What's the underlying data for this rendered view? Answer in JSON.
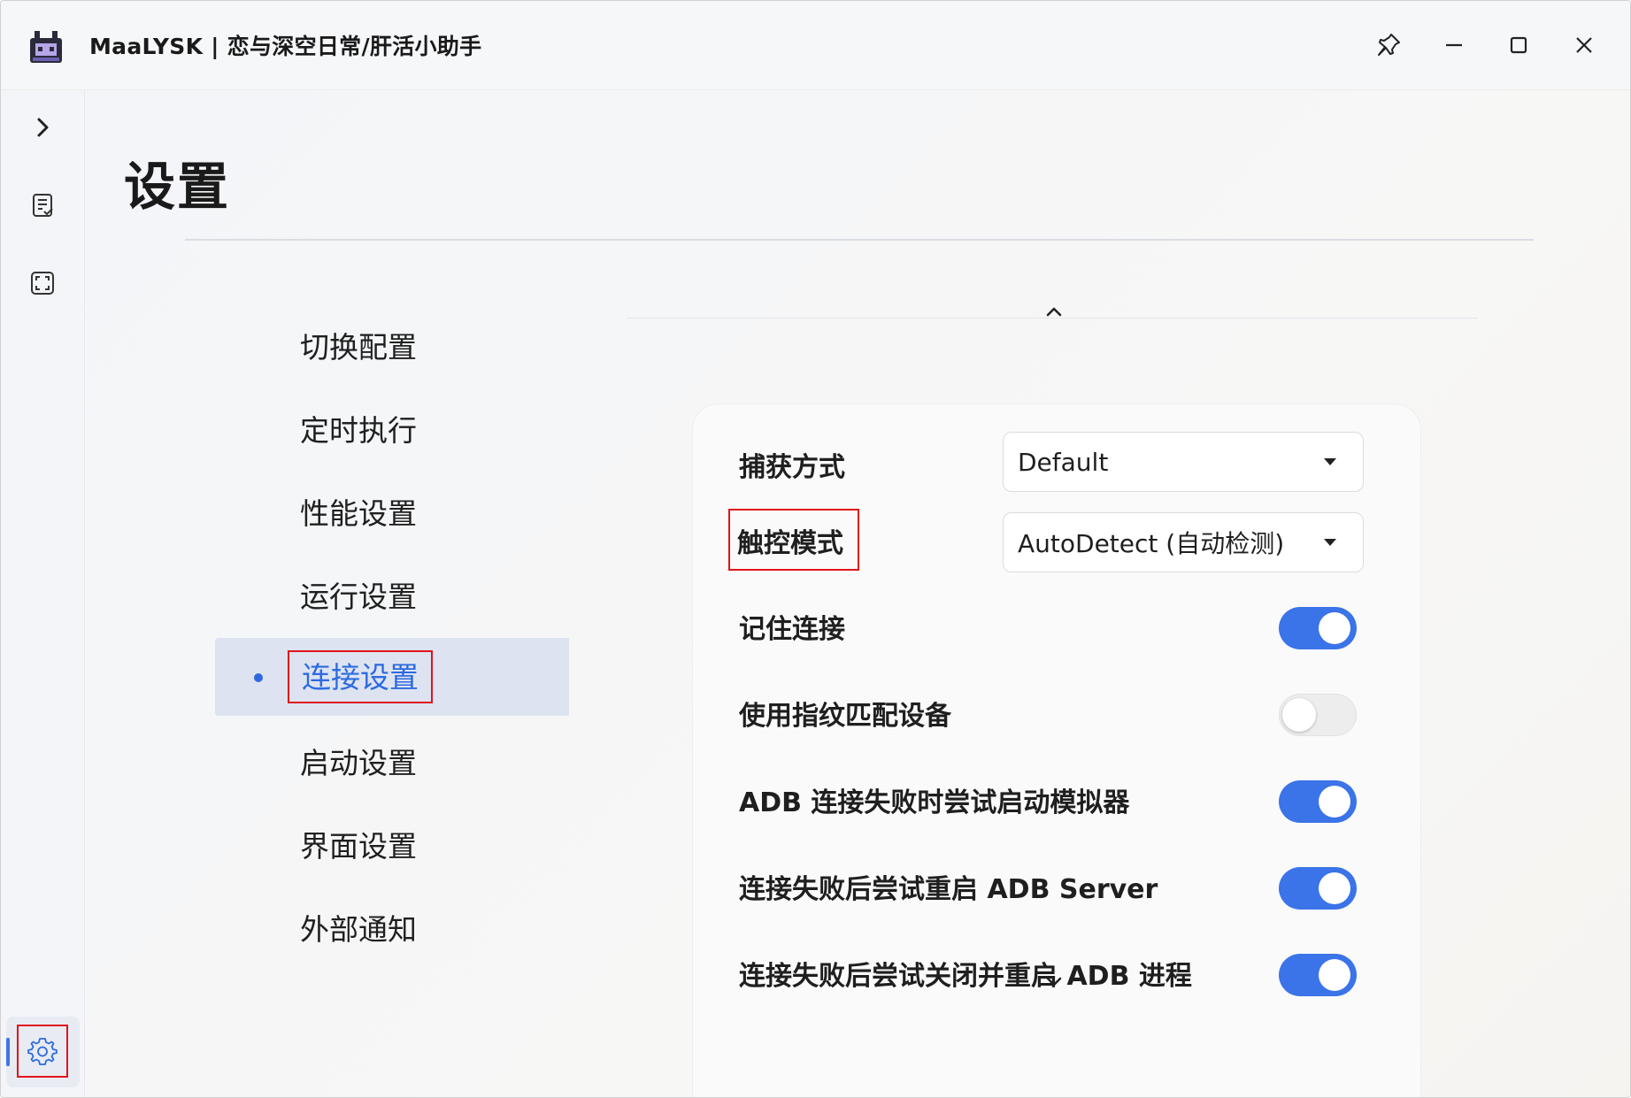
{
  "window": {
    "title": "MaaLYSK | 恋与深空日常/肝活小助手",
    "buttons": {
      "pin": "pin-icon",
      "minimize": "minimize-icon",
      "maximize": "maximize-icon",
      "close": "close-icon"
    }
  },
  "navrail": {
    "items": [
      {
        "icon": "chevron-right-icon"
      },
      {
        "icon": "task-list-icon"
      },
      {
        "icon": "screenshot-frame-icon"
      }
    ],
    "settings_icon": "gear-icon",
    "accent": "#3b73e8"
  },
  "page": {
    "title": "设置"
  },
  "menu": {
    "items": [
      {
        "label": "切换配置"
      },
      {
        "label": "定时执行"
      },
      {
        "label": "性能设置"
      },
      {
        "label": "运行设置"
      },
      {
        "label": "连接设置",
        "active": true
      },
      {
        "label": "启动设置"
      },
      {
        "label": "界面设置"
      },
      {
        "label": "外部通知"
      }
    ]
  },
  "connection": {
    "capture_label": "捕获方式",
    "capture_value": "Default",
    "touch_label": "触控模式",
    "touch_value": "AutoDetect (自动检测)",
    "toggles": [
      {
        "label": "记住连接",
        "on": true
      },
      {
        "label": "使用指纹匹配设备",
        "on": false
      },
      {
        "label": "ADB 连接失败时尝试启动模拟器",
        "on": true
      },
      {
        "label": "连接失败后尝试重启 ADB Server",
        "on": true
      },
      {
        "label": "连接失败后尝试关闭并重启 ADB 进程",
        "on": true
      }
    ]
  },
  "colors": {
    "highlight_box": "#e0141a",
    "active_text": "#2d6ae0",
    "toggle_on": "#3b73e8"
  }
}
